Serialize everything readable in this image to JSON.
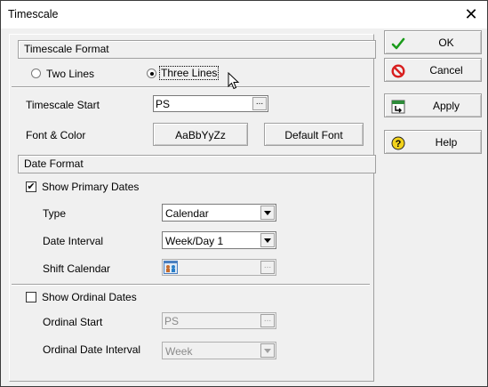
{
  "window": {
    "title": "Timescale"
  },
  "timescale_format": {
    "header": "Timescale Format",
    "two_lines_label": "Two Lines",
    "three_lines_label": "Three Lines",
    "selected": "three_lines",
    "timescale_start_label": "Timescale Start",
    "timescale_start_value": "PS",
    "font_color_label": "Font & Color",
    "font_sample_button": "AaBbYyZz",
    "default_font_button": "Default Font"
  },
  "date_format": {
    "header": "Date Format",
    "show_primary_label": "Show Primary Dates",
    "show_primary_checked": true,
    "type_label": "Type",
    "type_value": "Calendar",
    "date_interval_label": "Date Interval",
    "date_interval_value": "Week/Day 1",
    "shift_calendar_label": "Shift Calendar",
    "show_ordinal_label": "Show Ordinal Dates",
    "show_ordinal_checked": false,
    "ordinal_start_label": "Ordinal Start",
    "ordinal_start_value": "PS",
    "ordinal_interval_label": "Ordinal Date Interval",
    "ordinal_interval_value": "Week"
  },
  "side_buttons": {
    "ok": "OK",
    "cancel": "Cancel",
    "apply": "Apply",
    "help": "Help"
  },
  "ellipsis": "...",
  "colors": {
    "ok_check": "#1a9b1a",
    "cancel_red": "#d81e1e",
    "help_yellow": "#f2d21b"
  }
}
